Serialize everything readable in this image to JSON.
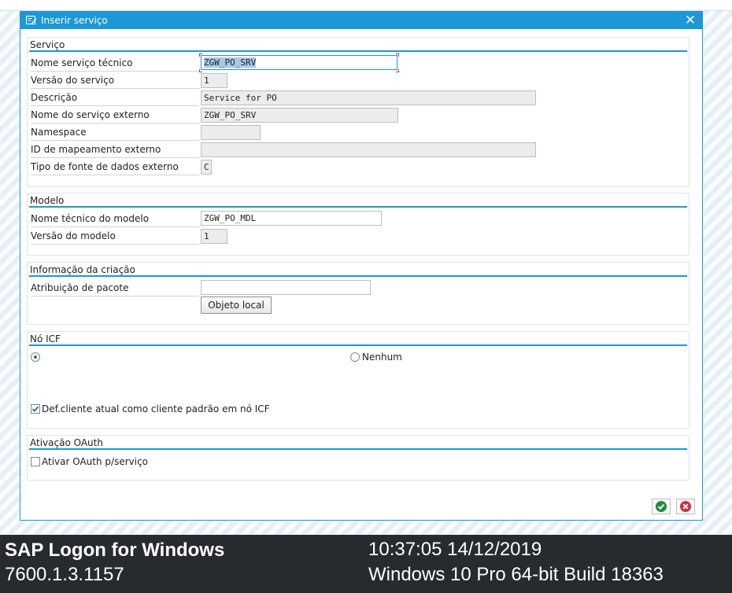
{
  "dialog": {
    "title": "Inserir serviço",
    "close_glyph": "✕"
  },
  "servico": {
    "title": "Serviço",
    "fields": [
      {
        "label": "Nome serviço técnico",
        "value": "ZGW_PO_SRV",
        "editable": true,
        "focused": true
      },
      {
        "label": "Versão do serviço",
        "value": "1",
        "editable": false
      },
      {
        "label": "Descrição",
        "value": "Service for PO",
        "editable": false
      },
      {
        "label": "Nome do serviço externo",
        "value": "ZGW_PO_SRV",
        "editable": false
      },
      {
        "label": "Namespace",
        "value": "",
        "editable": false
      },
      {
        "label": "ID de mapeamento externo",
        "value": "",
        "editable": false
      },
      {
        "label": "Tipo de fonte de dados externo",
        "value": "C",
        "editable": false
      }
    ]
  },
  "modelo": {
    "title": "Modelo",
    "fields": [
      {
        "label": "Nome técnico do modelo",
        "value": "ZGW_PO_MDL",
        "editable": true
      },
      {
        "label": "Versão do modelo",
        "value": "1",
        "editable": false
      }
    ]
  },
  "criacao": {
    "title": "Informação da criação",
    "pacote_label": "Atribuição de pacote",
    "pacote_value": "",
    "objeto_local_button": "Objeto local"
  },
  "icf": {
    "title": "Nó ICF",
    "radio_default_selected": true,
    "radio_nenhum_label": "Nenhum",
    "radio_nenhum_selected": false,
    "checkbox_label": "Def.cliente atual como cliente padrão em nó ICF",
    "checkbox_checked": true
  },
  "oauth": {
    "title": "Ativação OAuth",
    "checkbox_label": "Ativar OAuth p/serviço",
    "checkbox_checked": false
  },
  "actions": {
    "confirm_icon": "checkmark-icon",
    "cancel_icon": "cancel-icon",
    "confirm_color": "#1f8a3c",
    "cancel_color": "#d0303a"
  },
  "footer": {
    "app_name": "SAP Logon for Windows",
    "version": "7600.1.3.1157",
    "datetime": "10:37:05 14/12/2019",
    "os": "Windows 10 Pro 64-bit Build 18363"
  },
  "colors": {
    "accent": "#1c98d6",
    "footer_bg": "#272b30"
  }
}
